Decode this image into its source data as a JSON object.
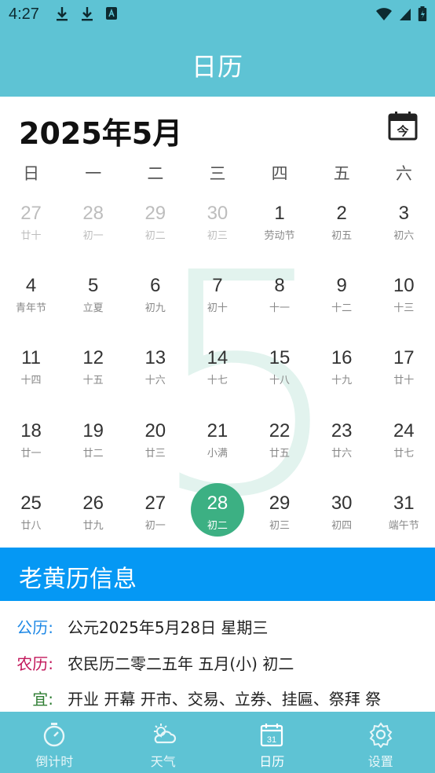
{
  "status_bar": {
    "time": "4:27"
  },
  "app_bar": {
    "title": "日历"
  },
  "calendar": {
    "month_title": "2025年5月",
    "watermark": "5",
    "weekdays": [
      "日",
      "一",
      "二",
      "三",
      "四",
      "五",
      "六"
    ],
    "weeks": [
      [
        {
          "day": "27",
          "sub": "廿十",
          "other": true
        },
        {
          "day": "28",
          "sub": "初一",
          "other": true
        },
        {
          "day": "29",
          "sub": "初二",
          "other": true
        },
        {
          "day": "30",
          "sub": "初三",
          "other": true
        },
        {
          "day": "1",
          "sub": "劳动节"
        },
        {
          "day": "2",
          "sub": "初五"
        },
        {
          "day": "3",
          "sub": "初六"
        }
      ],
      [
        {
          "day": "4",
          "sub": "青年节"
        },
        {
          "day": "5",
          "sub": "立夏"
        },
        {
          "day": "6",
          "sub": "初九"
        },
        {
          "day": "7",
          "sub": "初十"
        },
        {
          "day": "8",
          "sub": "十一"
        },
        {
          "day": "9",
          "sub": "十二"
        },
        {
          "day": "10",
          "sub": "十三"
        }
      ],
      [
        {
          "day": "11",
          "sub": "十四"
        },
        {
          "day": "12",
          "sub": "十五"
        },
        {
          "day": "13",
          "sub": "十六"
        },
        {
          "day": "14",
          "sub": "十七"
        },
        {
          "day": "15",
          "sub": "十八"
        },
        {
          "day": "16",
          "sub": "十九"
        },
        {
          "day": "17",
          "sub": "廿十"
        }
      ],
      [
        {
          "day": "18",
          "sub": "廿一"
        },
        {
          "day": "19",
          "sub": "廿二"
        },
        {
          "day": "20",
          "sub": "廿三"
        },
        {
          "day": "21",
          "sub": "小满"
        },
        {
          "day": "22",
          "sub": "廿五"
        },
        {
          "day": "23",
          "sub": "廿六"
        },
        {
          "day": "24",
          "sub": "廿七"
        }
      ],
      [
        {
          "day": "25",
          "sub": "廿八"
        },
        {
          "day": "26",
          "sub": "廿九"
        },
        {
          "day": "27",
          "sub": "初一"
        },
        {
          "day": "28",
          "sub": "初二",
          "selected": true
        },
        {
          "day": "29",
          "sub": "初三"
        },
        {
          "day": "30",
          "sub": "初四"
        },
        {
          "day": "31",
          "sub": "端午节"
        }
      ]
    ]
  },
  "almanac": {
    "title": "老黄历信息",
    "solar_label": "公历:",
    "solar_value": "公元2025年5月28日 星期三",
    "lunar_label": "农历:",
    "lunar_value": "农民历二零二五年 五月(小) 初二",
    "yi_label": "宜:",
    "yi_value": "开业 开幕 开市、交易、立券、挂匾、祭拜 祭"
  },
  "bottom_nav": {
    "items": [
      {
        "label": "倒计时",
        "icon": "stopwatch-icon"
      },
      {
        "label": "天气",
        "icon": "weather-icon"
      },
      {
        "label": "日历",
        "icon": "calendar-icon",
        "active": true
      },
      {
        "label": "设置",
        "icon": "gear-icon"
      }
    ]
  },
  "colors": {
    "app_bar": "#5ec3d4",
    "selected_day": "#3cb083",
    "almanac_header": "#0598f4",
    "solar_label": "#1e88e5",
    "lunar_label": "#c2185b",
    "yi_label": "#2e7d32"
  }
}
